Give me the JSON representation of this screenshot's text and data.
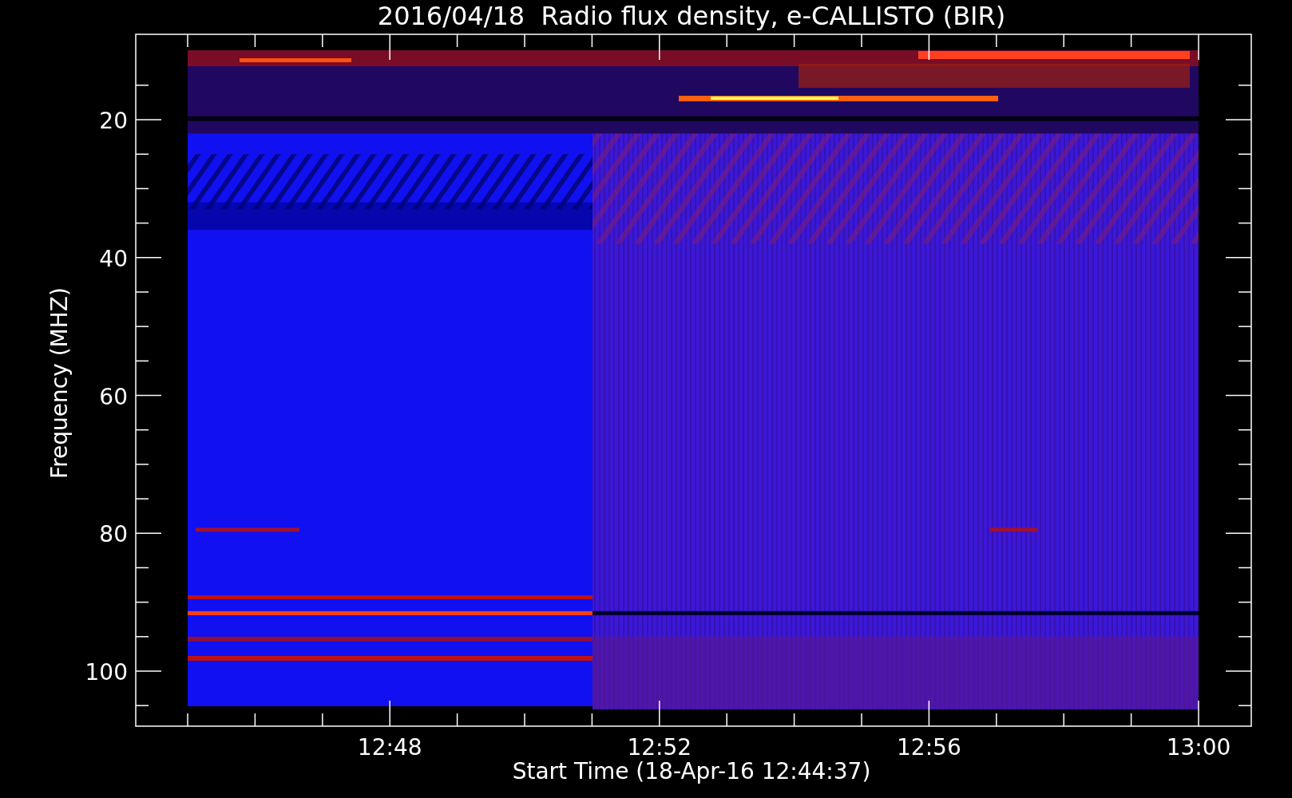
{
  "title": "2016/04/18  Radio flux density, e-CALLISTO (BIR)",
  "y_axis": {
    "label": "Frequency (MHZ)",
    "ticks": [
      "20",
      "40",
      "60",
      "80",
      "100"
    ]
  },
  "x_axis": {
    "label": "Start Time (18-Apr-16 12:44:37)",
    "ticks": [
      "12:48",
      "12:52",
      "12:56",
      "13:00"
    ]
  }
}
